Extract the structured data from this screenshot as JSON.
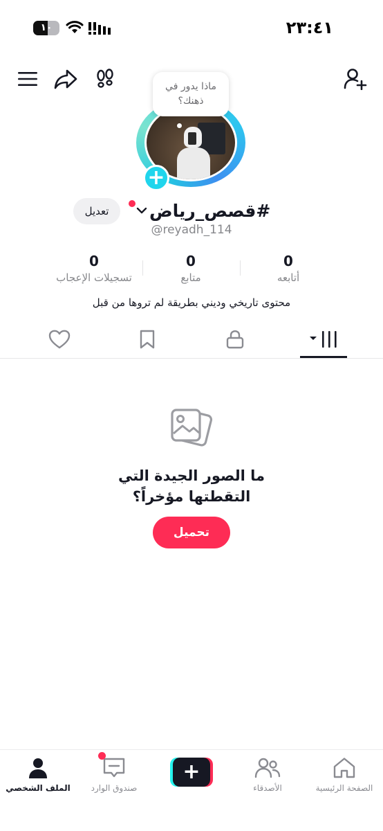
{
  "status_bar": {
    "time": "٢٣:٤١",
    "battery_level": "١٠"
  },
  "profile": {
    "thought_bubble": "ماذا يدور في ذهنك؟",
    "display_name": "#قصص_رياض",
    "username": "@reyadh_114",
    "edit_label": "تعديل",
    "bio": "محتوى تاريخي وديني بطريقة لم تروها من قبل"
  },
  "stats": {
    "following": {
      "value": "0",
      "label": "أتابعه"
    },
    "followers": {
      "value": "0",
      "label": "متابع"
    },
    "likes": {
      "value": "0",
      "label": "تسجيلات الإعجاب"
    }
  },
  "empty_state": {
    "title_line1": "ما الصور الجيدة التي",
    "title_line2": "التقطتها مؤخراً؟",
    "upload_label": "تحميل"
  },
  "bottom_nav": {
    "home": "الصفحة الرئيسية",
    "friends": "الأصدقاء",
    "inbox": "صندوق الوارد",
    "profile": "الملف الشخصي"
  },
  "colors": {
    "accent": "#fe2c55",
    "badge": "#20d5ec",
    "text": "#161823",
    "muted": "#86878b"
  }
}
